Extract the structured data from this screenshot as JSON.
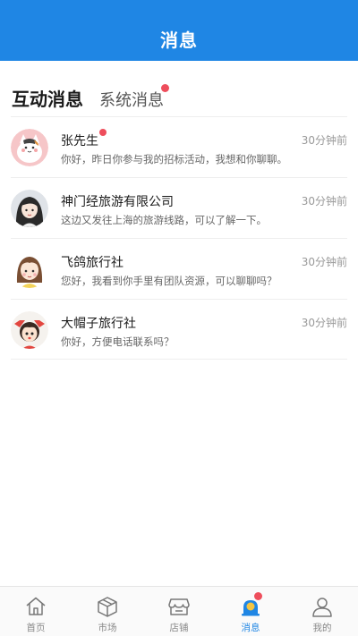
{
  "header": {
    "title": "消息"
  },
  "tabs": {
    "active": "互动消息",
    "inactive": "系统消息"
  },
  "messages": [
    {
      "name": "张先生",
      "unread": true,
      "preview": "你好，昨日你参与我的招标活动，我想和你聊聊。",
      "time": "30分钟前",
      "avatar": "cat-avatar"
    },
    {
      "name": "神门经旅游有限公司",
      "unread": false,
      "preview": "这边又发往上海的旅游线路，可以了解一下。",
      "time": "30分钟前",
      "avatar": "girl-dark-hair-avatar"
    },
    {
      "name": "飞鸽旅行社",
      "unread": false,
      "preview": "您好，我看到你手里有团队资源，可以聊聊吗？",
      "time": "30分钟前",
      "avatar": "girl-yellow-shirt-avatar"
    },
    {
      "name": "大帽子旅行社",
      "unread": false,
      "preview": "你好，方便电话联系吗？",
      "time": "30分钟前",
      "avatar": "girl-red-bows-avatar"
    }
  ],
  "nav": {
    "home": "首页",
    "market": "市场",
    "shop": "店铺",
    "messages": "消息",
    "mine": "我的"
  },
  "colors": {
    "brand": "#1f86e4",
    "badge": "#ee4e5c"
  }
}
